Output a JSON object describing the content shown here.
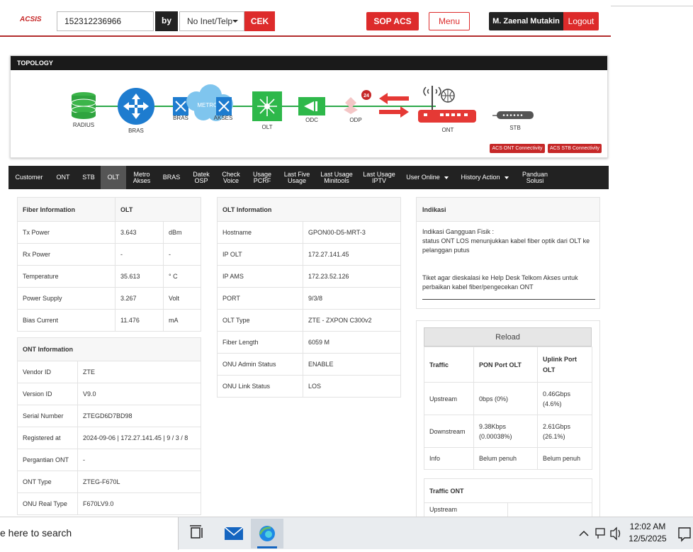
{
  "header": {
    "logo": "ACSIS",
    "search_value": "152312236966",
    "by_label": "by",
    "search_type": "No Inet/Telp",
    "cek_label": "CEK",
    "sop_label": "SOP ACS",
    "menu_label": "Menu",
    "user_name": "M. Zaenal Mutakin",
    "logout_label": "Logout"
  },
  "topology": {
    "title": "TOPOLOGY",
    "nodes": {
      "radius": "RADIUS",
      "bras": "BRAS",
      "bras2": "BRAS",
      "metro": "METRO - E",
      "akses": "AKSES",
      "olt": "OLT",
      "odc": "ODC",
      "odp": "ODP",
      "ont": "ONT",
      "stb": "STB"
    },
    "odp_badge": "24",
    "btn_ont": "ACS ONT Connectivity",
    "btn_stb": "ACS STB Connectivity"
  },
  "nav": {
    "tabs": [
      "Customer",
      "ONT",
      "STB",
      "OLT",
      "Metro Akses",
      "BRAS",
      "Datek OSP",
      "Check Voice",
      "Usage PCRF",
      "Last Five Usage",
      "Last Usage Minitools",
      "Last Usage IPTV",
      "User Online",
      "History Action",
      "Panduan Solusi"
    ],
    "active": "OLT"
  },
  "fiber": {
    "header": [
      "Fiber Information",
      "OLT"
    ],
    "rows": [
      {
        "label": "Tx Power",
        "value": "3.643",
        "unit": "dBm"
      },
      {
        "label": "Rx Power",
        "value": "-",
        "unit": "-"
      },
      {
        "label": "Temperature",
        "value": "35.613",
        "unit": "° C"
      },
      {
        "label": "Power Supply",
        "value": "3.267",
        "unit": "Volt"
      },
      {
        "label": "Bias Current",
        "value": "11.476",
        "unit": "mA"
      }
    ]
  },
  "ont_info": {
    "header": "ONT Information",
    "rows": [
      {
        "label": "Vendor ID",
        "value": "ZTE"
      },
      {
        "label": "Version ID",
        "value": "V9.0"
      },
      {
        "label": "Serial Number",
        "value": "ZTEGD6D7BD98"
      },
      {
        "label": "Registered at",
        "value": "2024-09-06 | 172.27.141.45 | 9 / 3 / 8"
      },
      {
        "label": "Pergantian ONT",
        "value": "-"
      },
      {
        "label": "ONT Type",
        "value": "ZTEG-F670L"
      },
      {
        "label": "ONU Real Type",
        "value": "F670LV9.0"
      }
    ]
  },
  "olt_info": {
    "header": "OLT Information",
    "rows": [
      {
        "label": "Hostname",
        "value": "GPON00-D5-MRT-3"
      },
      {
        "label": "IP OLT",
        "value": "172.27.141.45"
      },
      {
        "label": "IP AMS",
        "value": "172.23.52.126"
      },
      {
        "label": "PORT",
        "value": "9/3/8"
      },
      {
        "label": "OLT Type",
        "value": "ZTE - ZXPON C300v2"
      },
      {
        "label": "Fiber Length",
        "value": "6059 M"
      },
      {
        "label": "ONU Admin Status",
        "value": "ENABLE"
      },
      {
        "label": "ONU Link Status",
        "value": "LOS"
      }
    ]
  },
  "indikasi": {
    "header": "Indikasi",
    "line1": "Indikasi Gangguan Fisik :",
    "line2": "status ONT LOS menunjukkan kabel fiber optik dari OLT ke pelanggan putus",
    "line3": "Tiket agar dieskalasi ke Help Desk Telkom Akses untuk perbaikan kabel fiber/pengecekan ONT"
  },
  "traffic": {
    "reload_label": "Reload",
    "headers": [
      "Traffic",
      "PON Port OLT",
      "Uplink Port OLT"
    ],
    "rows": [
      {
        "label": "Upstream",
        "pon": "0bps (0%)",
        "uplink": "0.46Gbps (4.6%)"
      },
      {
        "label": "Downstream",
        "pon": "9.38Kbps (0.00038%)",
        "uplink": "2.61Gbps (26.1%)"
      },
      {
        "label": "Info",
        "pon": "Belum penuh",
        "uplink": "Belum penuh"
      }
    ],
    "ont_header": "Traffic ONT",
    "ont_first_row": "Upstream"
  },
  "taskbar": {
    "search_text": "e here to search",
    "time": "12:02 AM",
    "date": "12/5/2025"
  }
}
